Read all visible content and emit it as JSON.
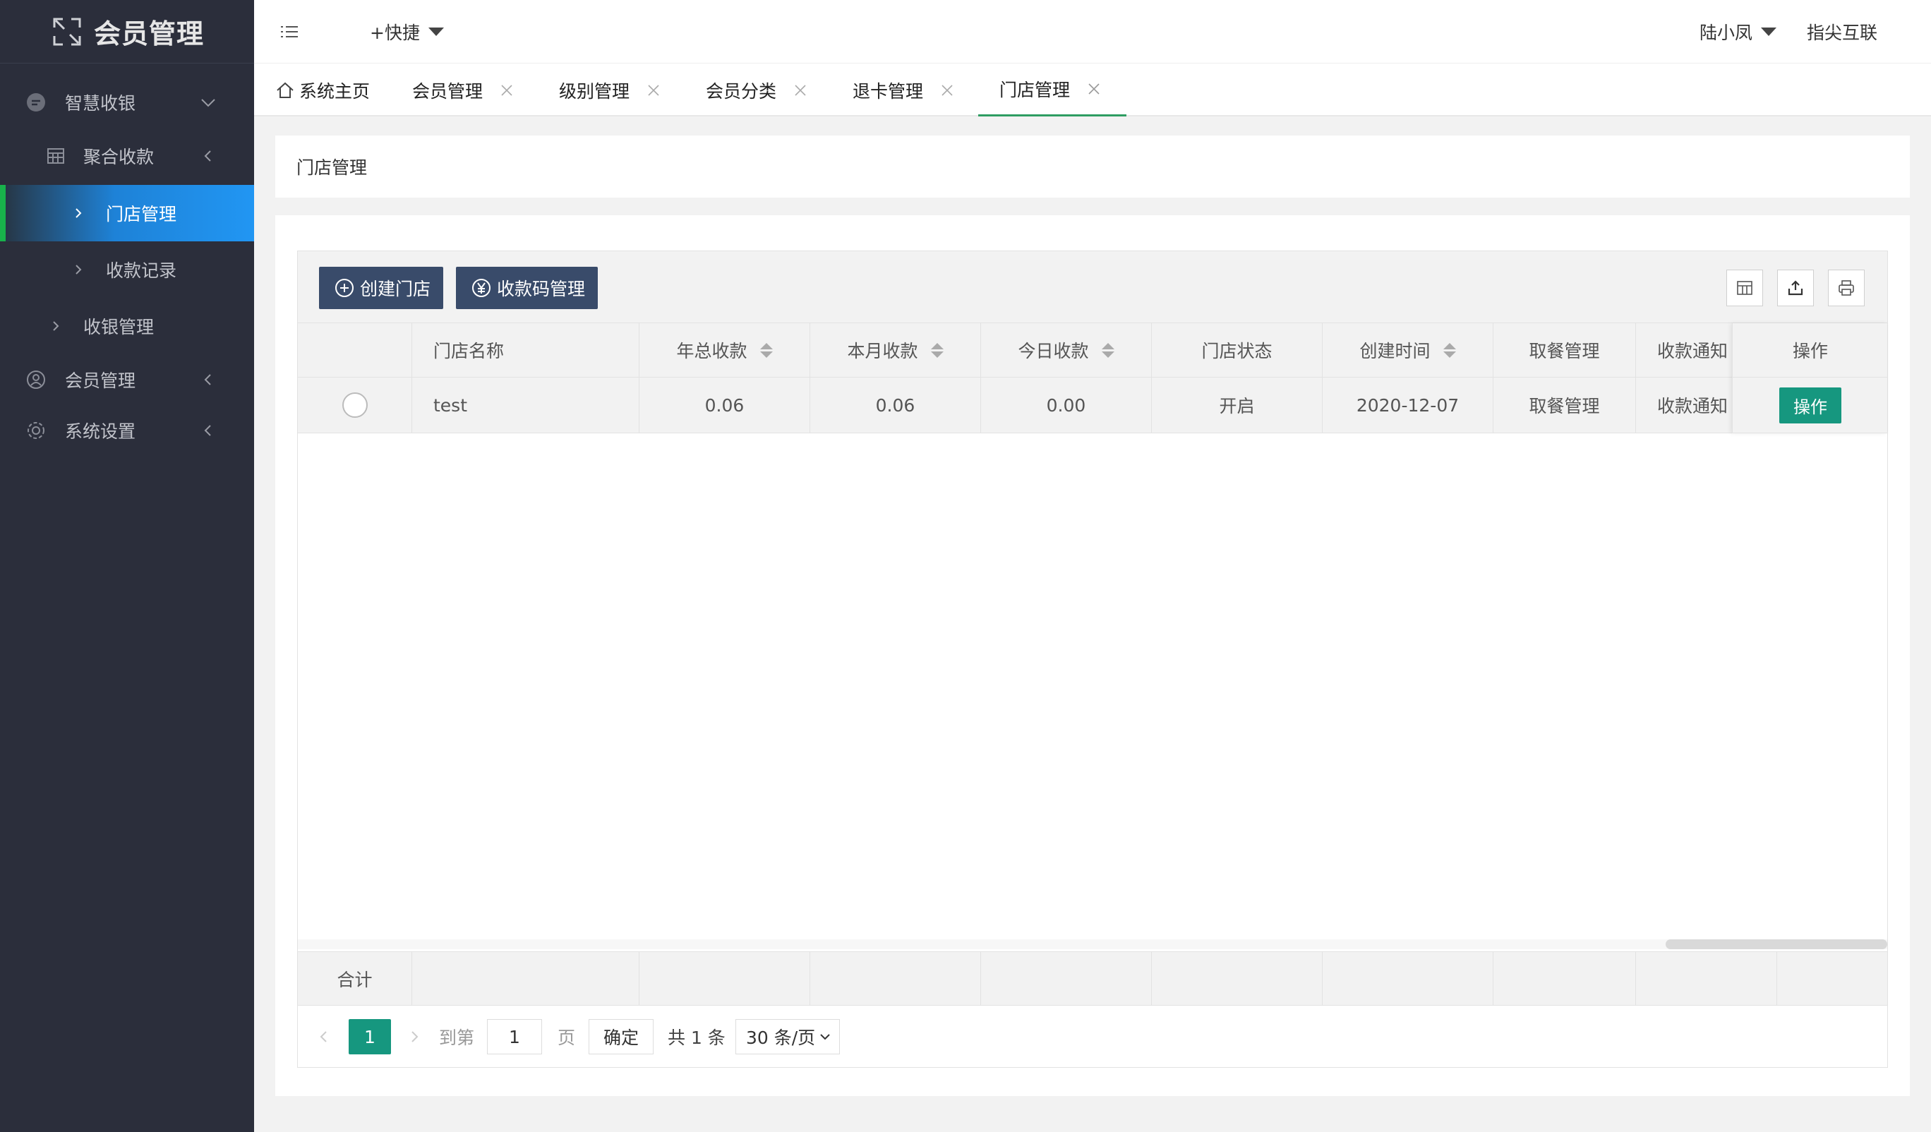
{
  "app": {
    "title": "会员管理"
  },
  "sidebar": {
    "items": [
      {
        "label": "智慧收银",
        "icon": "chat-icon",
        "arrow": "chevron-down-icon"
      },
      {
        "label": "聚合收款",
        "icon": "table-icon",
        "arrow": "chevron-left-icon"
      },
      {
        "label": "门店管理",
        "icon": "chevron-right-icon",
        "active": true
      },
      {
        "label": "收款记录",
        "icon": "chevron-right-icon"
      },
      {
        "label": "收银管理",
        "icon": "chevron-right-icon"
      },
      {
        "label": "会员管理",
        "icon": "user-icon",
        "arrow": "chevron-left-icon"
      },
      {
        "label": "系统设置",
        "icon": "gear-icon",
        "arrow": "chevron-left-icon"
      }
    ]
  },
  "header": {
    "quick_label": "+快捷",
    "user_name": "陆小凤",
    "brand": "指尖互联"
  },
  "tabs": [
    {
      "label": "系统主页",
      "icon": "home-icon"
    },
    {
      "label": "会员管理"
    },
    {
      "label": "级别管理"
    },
    {
      "label": "会员分类"
    },
    {
      "label": "退卡管理"
    },
    {
      "label": "门店管理",
      "active": true
    }
  ],
  "page": {
    "title": "门店管理"
  },
  "toolbar": {
    "create_store": "创建门店",
    "qr_manage": "收款码管理"
  },
  "table": {
    "columns": [
      "门店名称",
      "年总收款",
      "本月收款",
      "今日收款",
      "门店状态",
      "创建时间",
      "取餐管理",
      "收款通知",
      "操作"
    ],
    "rows": [
      {
        "name": "test",
        "year_total": "0.06",
        "month_total": "0.06",
        "today_total": "0.00",
        "status": "开启",
        "created": "2020-12-07",
        "meal": "取餐管理",
        "notify": "收款通知",
        "action": "操作"
      }
    ],
    "footer_label": "合计"
  },
  "pager": {
    "current_page": "1",
    "goto_label": "到第",
    "goto_value": "1",
    "page_unit": "页",
    "confirm": "确定",
    "total": "共 1 条",
    "page_size": "30 条/页"
  },
  "colors": {
    "sidebar_bg": "#2b2e3b",
    "accent_green": "#16977f",
    "button_blue": "#394b6a",
    "active_blue": "#2196f3"
  }
}
